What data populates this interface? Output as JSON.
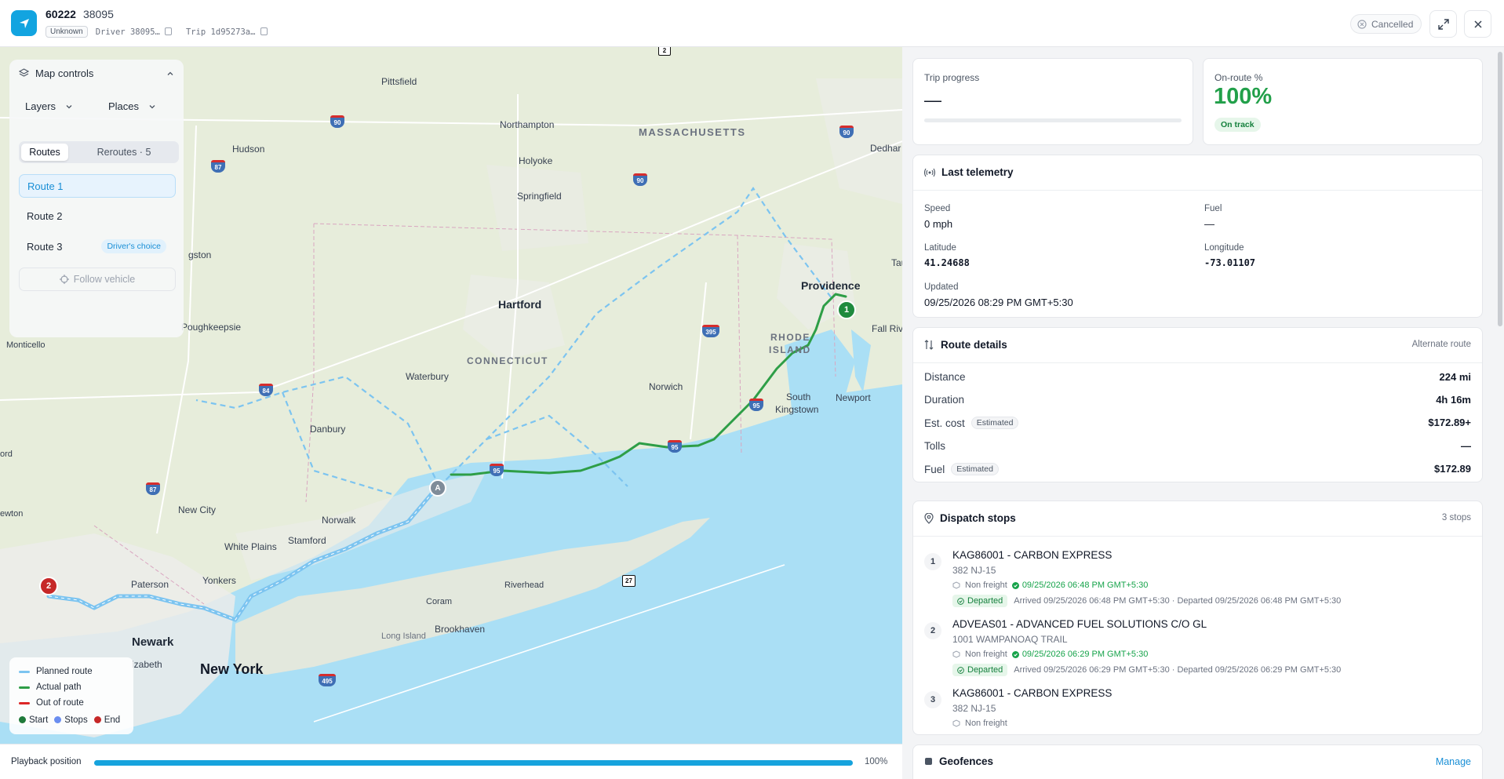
{
  "header": {
    "title_id": "60222",
    "title_sub": "38095",
    "status_badge": "Unknown",
    "driver": "Driver 38095…",
    "trip": "Trip 1d95273a…",
    "trip_status": "Cancelled"
  },
  "map": {
    "controls": {
      "title": "Map controls",
      "layers_label": "Layers",
      "places_label": "Places",
      "tabs": [
        "Routes",
        "Reroutes · 5"
      ],
      "routes": [
        "Route 1",
        "Route 2",
        "Route 3"
      ],
      "route3_badge": "Driver's choice",
      "follow_label": "Follow vehicle"
    },
    "places": {
      "pittsfield": "Pittsfield",
      "northampton": "Northampton",
      "holyoke": "Holyoke",
      "springfield": "Springfield",
      "hudson": "Hudson",
      "kingston": "gston",
      "dedham": "Dedhar",
      "taunton": "Tau",
      "providence": "Providence",
      "fall_river": "Fall Riv",
      "hartford": "Hartford",
      "poughkeepsie": "Poughkeepsie",
      "monticello": "Monticello",
      "waterbury": "Waterbury",
      "norwich": "Norwich",
      "south_kingstown_1": "South",
      "south_kingstown_2": "Kingstown",
      "newport": "Newport",
      "danbury": "Danbury",
      "new_city": "New City",
      "norwalk": "Norwalk",
      "stamford": "Stamford",
      "white_plains": "White Plains",
      "newton": "ewton",
      "ford": "ord",
      "paterson": "Paterson",
      "yonkers": "Yonkers",
      "riverhead": "Riverhead",
      "coram": "Coram",
      "brookhaven": "Brookhaven",
      "long_island": "Long Island",
      "newark": "Newark",
      "elizabeth": "izabeth",
      "new_york": "New York",
      "massachusetts": "MASSACHUSETTS",
      "connecticut": "CONNECTICUT",
      "rhode_island_1": "RHODE",
      "rhode_island_2": "ISLAND"
    },
    "shields": {
      "i90a": "90",
      "i90b": "90",
      "i90c": "90",
      "i87a": "87",
      "i87b": "87",
      "i84": "84",
      "i395": "395",
      "i95a": "95",
      "i95b": "95",
      "i95c": "95",
      "i95d": "95",
      "i495": "495",
      "r27": "27",
      "r2": "2"
    },
    "markers": {
      "start": "1",
      "end": "2",
      "vehicle": "A"
    },
    "legend": {
      "planned": "Planned route",
      "actual": "Actual path",
      "out": "Out of route",
      "start": "Start",
      "stops": "Stops",
      "end": "End"
    },
    "colors": {
      "planned": "#7cc4f0",
      "actual": "#2e9e47",
      "out": "#dc2626",
      "start": "#1f7a3a",
      "stops": "#6b8ef0",
      "end": "#c62828"
    }
  },
  "playback": {
    "label": "Playback position",
    "value": "100%",
    "progress": 1.0
  },
  "trip_progress": {
    "label": "Trip progress",
    "value": "—"
  },
  "on_route": {
    "label": "On-route %",
    "value": "100%",
    "status": "On track"
  },
  "telemetry": {
    "title": "Last telemetry",
    "speed_label": "Speed",
    "speed": "0 mph",
    "fuel_label": "Fuel",
    "fuel": "—",
    "lat_label": "Latitude",
    "lat": "41.24688",
    "lon_label": "Longitude",
    "lon": "-73.01107",
    "updated_label": "Updated",
    "updated": "09/25/2026 08:29 PM GMT+5:30"
  },
  "route_details": {
    "title": "Route details",
    "right": "Alternate route",
    "estimated": "Estimated",
    "rows": [
      {
        "label": "Distance",
        "value": "224 mi"
      },
      {
        "label": "Duration",
        "value": "4h 16m"
      },
      {
        "label": "Est. cost",
        "value": "$172.89+"
      },
      {
        "label": "Tolls",
        "value": "—"
      },
      {
        "label": "Fuel",
        "value": "$172.89"
      }
    ]
  },
  "dispatch": {
    "title": "Dispatch stops",
    "count": "3 stops",
    "stops": [
      {
        "num": "1",
        "name": "KAG86001 - CARBON EXPRESS",
        "addr": "382 NJ-15",
        "freight": "Non freight",
        "time": "09/25/2026 06:48 PM GMT+5:30",
        "status": "Departed",
        "detail": "Arrived 09/25/2026 06:48 PM GMT+5:30 · Departed 09/25/2026 06:48 PM GMT+5:30"
      },
      {
        "num": "2",
        "name": "ADVEAS01 - ADVANCED FUEL SOLUTIONS C/O GL",
        "addr": "1001 WAMPANOAQ TRAIL",
        "freight": "Non freight",
        "time": "09/25/2026 06:29 PM GMT+5:30",
        "status": "Departed",
        "detail": "Arrived 09/25/2026 06:29 PM GMT+5:30 · Departed 09/25/2026 06:29 PM GMT+5:30"
      },
      {
        "num": "3",
        "name": "KAG86001 - CARBON EXPRESS",
        "addr": "382 NJ-15",
        "freight": "Non freight"
      }
    ]
  },
  "geofences": {
    "title": "Geofences",
    "action": "Manage"
  }
}
